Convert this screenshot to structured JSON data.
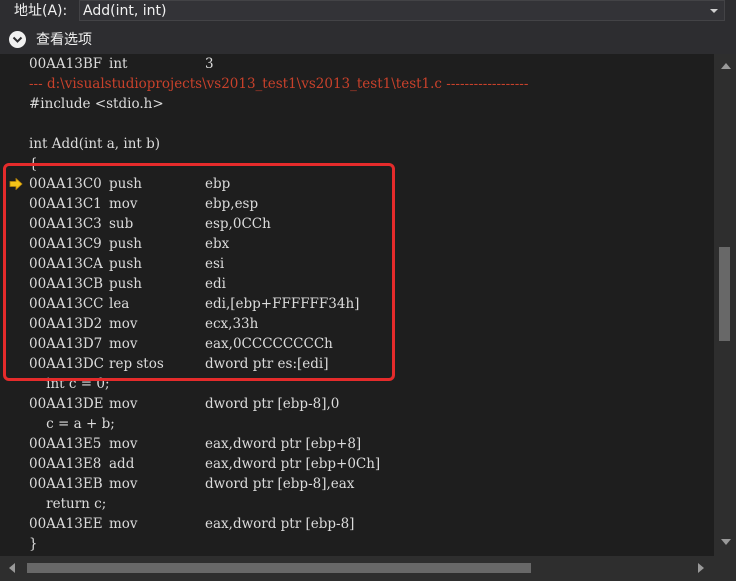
{
  "address_bar": {
    "label": "地址(A):",
    "value": "Add(int, int)"
  },
  "view_options": {
    "label": "查看选项",
    "icon": "chevron-down-circle-icon"
  },
  "lines": [
    {
      "kind": "asm",
      "addr": "00AA13BF",
      "op": "int",
      "args": "3"
    },
    {
      "kind": "file",
      "text": "--- d:\\visualstudioprojects\\vs2013_test1\\vs2013_test1\\test1.c ------------------"
    },
    {
      "kind": "src",
      "text": "#include <stdio.h>"
    },
    {
      "kind": "src",
      "text": ""
    },
    {
      "kind": "src",
      "text": "int Add(int a, int b)"
    },
    {
      "kind": "src",
      "text": "{"
    },
    {
      "kind": "asm",
      "addr": "00AA13C0",
      "op": "push",
      "args": "ebp"
    },
    {
      "kind": "asm",
      "addr": "00AA13C1",
      "op": "mov",
      "args": "ebp,esp"
    },
    {
      "kind": "asm",
      "addr": "00AA13C3",
      "op": "sub",
      "args": "esp,0CCh"
    },
    {
      "kind": "asm",
      "addr": "00AA13C9",
      "op": "push",
      "args": "ebx"
    },
    {
      "kind": "asm",
      "addr": "00AA13CA",
      "op": "push",
      "args": "esi"
    },
    {
      "kind": "asm",
      "addr": "00AA13CB",
      "op": "push",
      "args": "edi"
    },
    {
      "kind": "asm",
      "addr": "00AA13CC",
      "op": "lea",
      "args": "edi,[ebp+FFFFFF34h]"
    },
    {
      "kind": "asm",
      "addr": "00AA13D2",
      "op": "mov",
      "args": "ecx,33h"
    },
    {
      "kind": "asm",
      "addr": "00AA13D7",
      "op": "mov",
      "args": "eax,0CCCCCCCCh"
    },
    {
      "kind": "asm",
      "addr": "00AA13DC",
      "op": "rep stos",
      "args": "dword ptr es:[edi]"
    },
    {
      "kind": "src",
      "text": "    int c = 0;"
    },
    {
      "kind": "asm",
      "addr": "00AA13DE",
      "op": "mov",
      "args": "dword ptr [ebp-8],0"
    },
    {
      "kind": "src",
      "text": "    c = a + b;"
    },
    {
      "kind": "asm",
      "addr": "00AA13E5",
      "op": "mov",
      "args": "eax,dword ptr [ebp+8]"
    },
    {
      "kind": "asm",
      "addr": "00AA13E8",
      "op": "add",
      "args": "eax,dword ptr [ebp+0Ch]"
    },
    {
      "kind": "asm",
      "addr": "00AA13EB",
      "op": "mov",
      "args": "dword ptr [ebp-8],eax"
    },
    {
      "kind": "src",
      "text": "    return c;"
    },
    {
      "kind": "asm",
      "addr": "00AA13EE",
      "op": "mov",
      "args": "eax,dword ptr [ebp-8]"
    },
    {
      "kind": "src",
      "text": "}"
    }
  ],
  "current_instruction": "00AA13C0",
  "colors": {
    "background": "#1e1e1e",
    "text": "#dcdcdc",
    "file_header": "#c8412b",
    "highlight_box": "#e52b2b",
    "ip_arrow": "#f5c518"
  }
}
